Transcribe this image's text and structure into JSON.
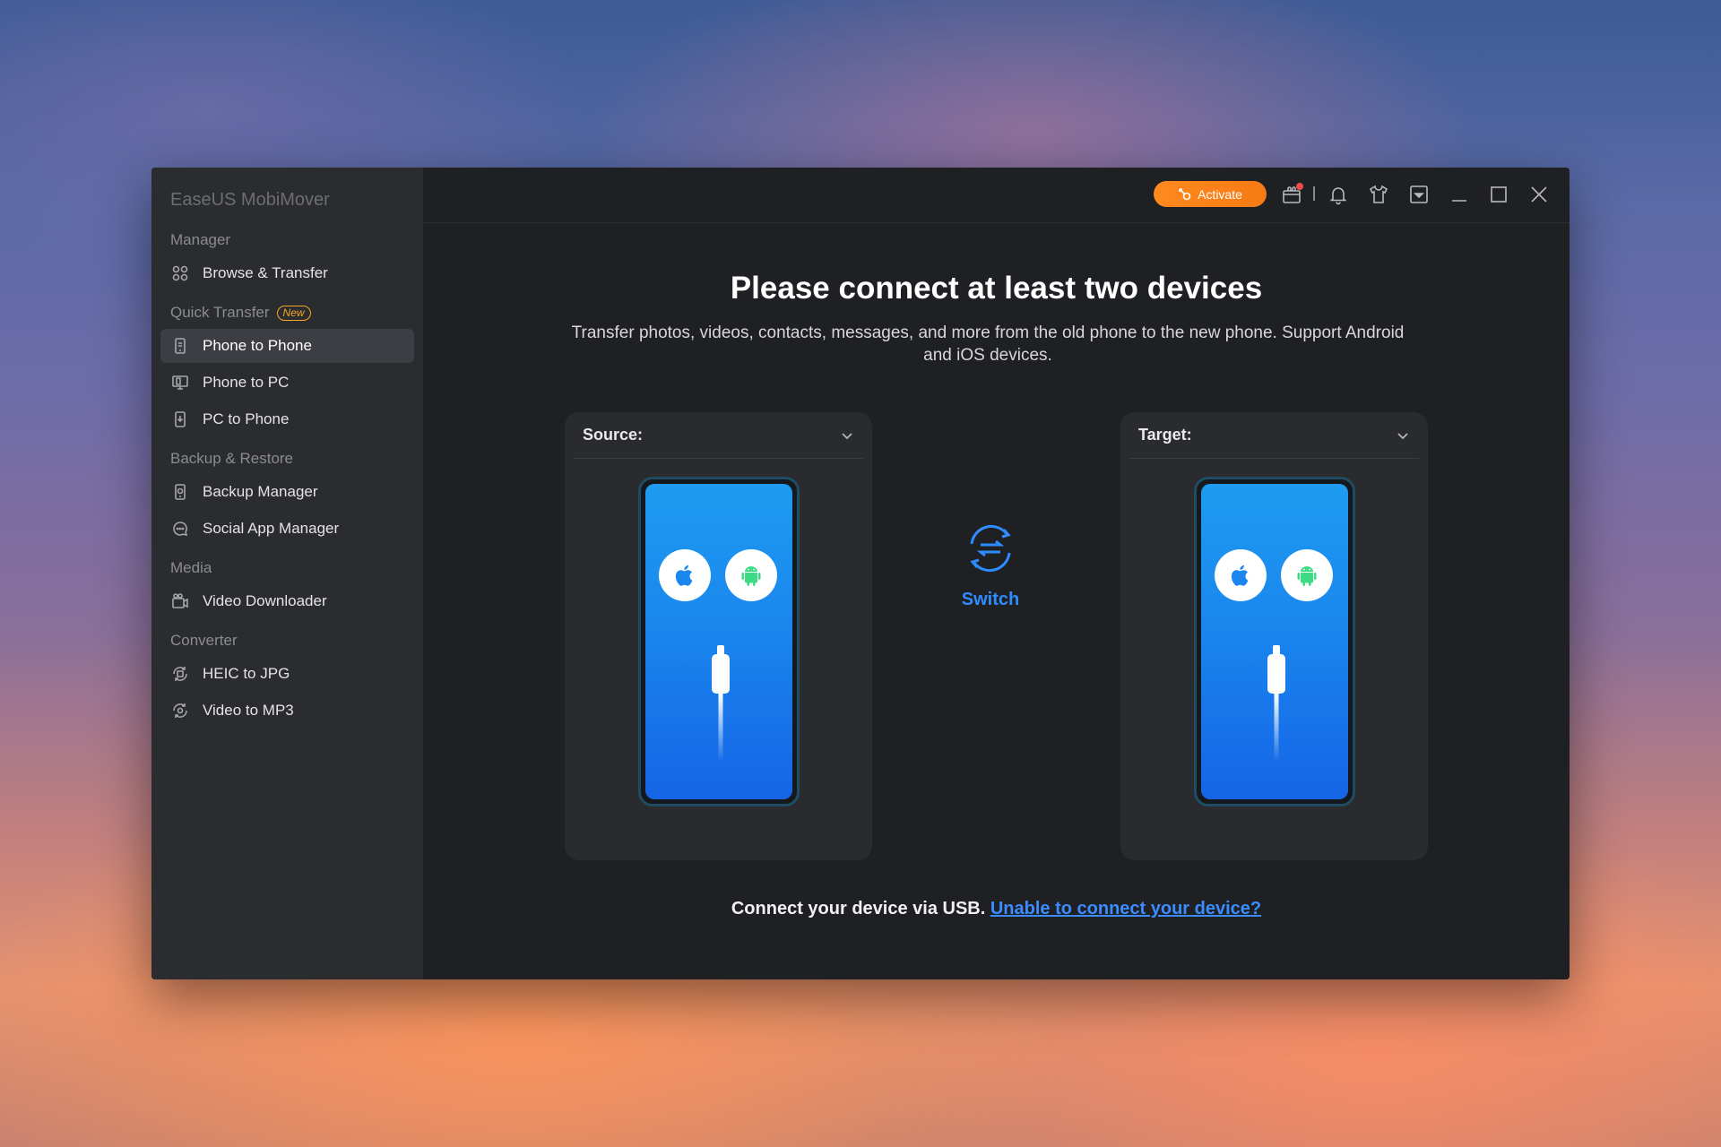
{
  "app": {
    "title": "EaseUS MobiMover"
  },
  "sidebar": {
    "sections": [
      {
        "label": "Manager",
        "badge": "",
        "items": [
          {
            "label": "Browse & Transfer",
            "icon": "grid-icon"
          }
        ]
      },
      {
        "label": "Quick Transfer",
        "badge": "New",
        "items": [
          {
            "label": "Phone to Phone",
            "icon": "phone-transfer-icon",
            "active": true
          },
          {
            "label": "Phone to PC",
            "icon": "monitor-icon"
          },
          {
            "label": "PC to Phone",
            "icon": "phone-icon"
          }
        ]
      },
      {
        "label": "Backup & Restore",
        "badge": "",
        "items": [
          {
            "label": "Backup Manager",
            "icon": "backup-icon"
          },
          {
            "label": "Social App Manager",
            "icon": "chat-icon"
          }
        ]
      },
      {
        "label": "Media",
        "badge": "",
        "items": [
          {
            "label": "Video Downloader",
            "icon": "video-icon"
          }
        ]
      },
      {
        "label": "Converter",
        "badge": "",
        "items": [
          {
            "label": "HEIC to JPG",
            "icon": "image-convert-icon"
          },
          {
            "label": "Video to MP3",
            "icon": "audio-convert-icon"
          }
        ]
      }
    ]
  },
  "topbar": {
    "activate_label": "Activate",
    "icons": [
      "gift-icon",
      "bell-icon",
      "shirt-icon",
      "dropdown-box-icon",
      "minimize-icon",
      "maximize-icon",
      "close-icon"
    ]
  },
  "main": {
    "headline": "Please connect at least two devices",
    "subline": "Transfer photos, videos, contacts, messages, and more from the old phone to the new phone. Support Android and iOS devices.",
    "source_label": "Source:",
    "target_label": "Target:",
    "switch_label": "Switch",
    "footer_text": "Connect your device via USB.",
    "footer_link": "Unable to connect your device?"
  },
  "colors": {
    "accent_orange": "#f67a13",
    "link_blue": "#3a8cff",
    "phone_blue": "#1a86ee"
  }
}
